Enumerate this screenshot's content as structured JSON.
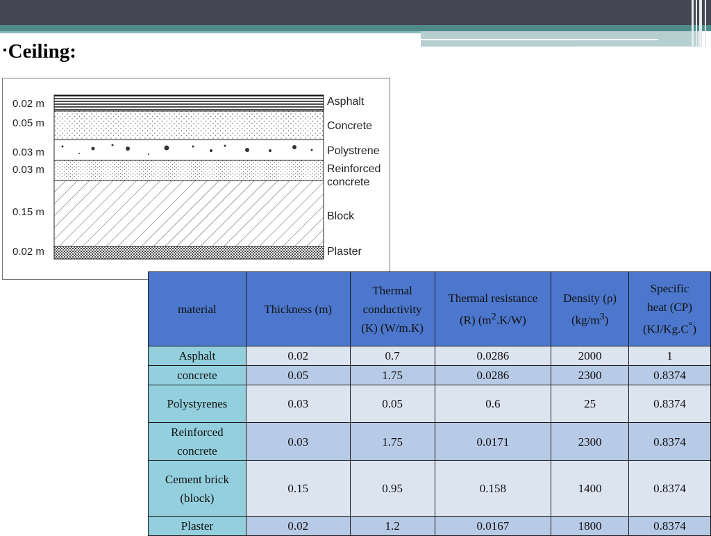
{
  "heading": {
    "bullet": "▪",
    "text": "Ceiling:"
  },
  "diagram": {
    "layers": [
      {
        "thickness": "0.02 m",
        "name": "Asphalt"
      },
      {
        "thickness": "0.05 m",
        "name": "Concrete"
      },
      {
        "thickness": "0.03 m",
        "name": "Polystrene"
      },
      {
        "thickness": "0.03 m",
        "name": "Reinforced concrete"
      },
      {
        "thickness": "0.15 m",
        "name": "Block"
      },
      {
        "thickness": "0.02 m",
        "name": "Plaster"
      }
    ],
    "reinforced_line1": "Reinforced",
    "reinforced_line2": "concrete"
  },
  "table": {
    "headers": {
      "material": "material",
      "thickness": "Thickness (m)",
      "conductivity_1": "Thermal",
      "conductivity_2": "conductivity",
      "conductivity_3": "(K) (W/m.K)",
      "resistance_1": "Thermal resistance",
      "resistance_2": "(R) (m",
      "resistance_sup": "2",
      "resistance_3": ".K/W)",
      "density_1": "Density (ρ)",
      "density_2": "(kg/m",
      "density_sup": "3",
      "density_3": ")",
      "heat_1": "Specific",
      "heat_2": "heat (CP)",
      "heat_3": "(KJ/Kg.C",
      "heat_sup": "°",
      "heat_4": ")"
    },
    "rows": [
      {
        "material": "Asphalt",
        "material_2": "",
        "thickness": "0.02",
        "conductivity": "0.7",
        "resistance": "0.0286",
        "density": "2000",
        "heat": "1"
      },
      {
        "material": "concrete",
        "material_2": "",
        "thickness": "0.05",
        "conductivity": "1.75",
        "resistance": "0.0286",
        "density": "2300",
        "heat": "0.8374"
      },
      {
        "material": "Polystyrenes",
        "material_2": "",
        "thickness": "0.03",
        "conductivity": "0.05",
        "resistance": "0.6",
        "density": "25",
        "heat": "0.8374"
      },
      {
        "material": "Reinforced",
        "material_2": "concrete",
        "thickness": "0.03",
        "conductivity": "1.75",
        "resistance": "0.0171",
        "density": "2300",
        "heat": "0.8374"
      },
      {
        "material": "Cement brick",
        "material_2": "(block)",
        "thickness": "0.15",
        "conductivity": "0.95",
        "resistance": "0.158",
        "density": "1400",
        "heat": "0.8374"
      },
      {
        "material": "Plaster",
        "material_2": "",
        "thickness": "0.02",
        "conductivity": "1.2",
        "resistance": "0.0167",
        "density": "1800",
        "heat": "0.8374"
      }
    ]
  },
  "colors": {
    "header_bg": "#4c77cc",
    "material_col_bg": "#93cfdd",
    "row_light": "#dce4f0",
    "row_dark": "#b8cbe6",
    "top_band": "#454553",
    "accent_teal": "#4f8a8b"
  }
}
